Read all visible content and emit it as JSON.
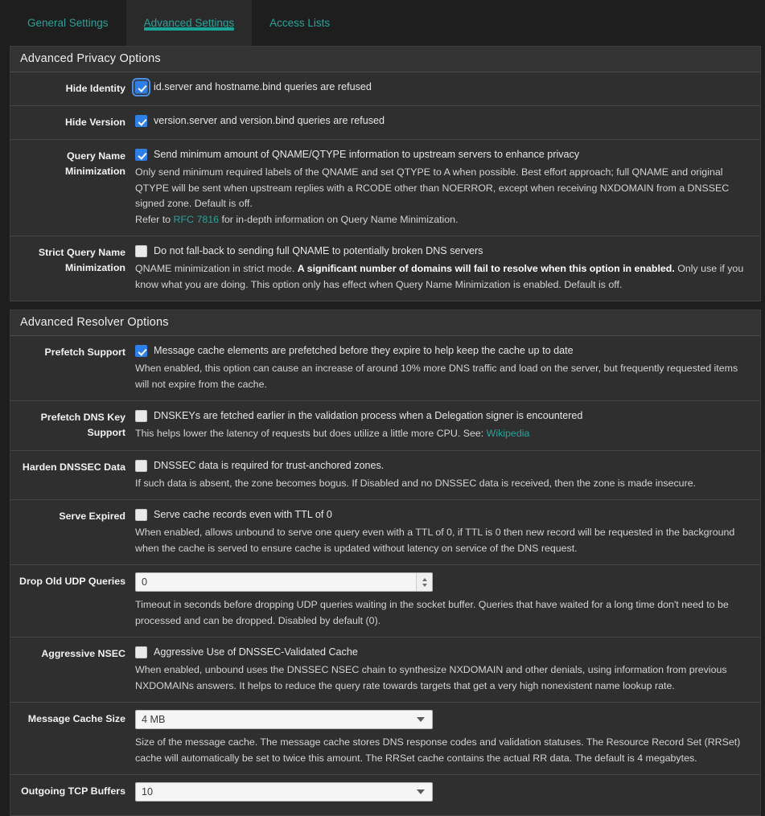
{
  "tabs": [
    {
      "label": "General Settings",
      "active": false
    },
    {
      "label": "Advanced Settings",
      "active": true
    },
    {
      "label": "Access Lists",
      "active": false
    }
  ],
  "colors": {
    "accent_teal": "#2aa198",
    "tab_underline": "#17a398",
    "checkbox_on": "#2f7fe8",
    "panel_bg": "#2f2f2f",
    "page_bg": "#1e1e1e"
  },
  "sections": [
    {
      "title": "Advanced Privacy Options",
      "rows": [
        {
          "label": "Hide Identity",
          "control": "checkbox",
          "checked": true,
          "focused": true,
          "checkbox_text": "id.server and hostname.bind queries are refused",
          "desc": []
        },
        {
          "label": "Hide Version",
          "control": "checkbox",
          "checked": true,
          "focused": false,
          "checkbox_text": "version.server and version.bind queries are refused",
          "desc": []
        },
        {
          "label": "Query Name Minimization",
          "control": "checkbox",
          "checked": true,
          "focused": false,
          "checkbox_text": "Send minimum amount of QNAME/QTYPE information to upstream servers to enhance privacy",
          "desc": [
            "Only send minimum required labels of the QNAME and set QTYPE to A when possible. Best effort approach; full QNAME and original QTYPE will be sent when upstream replies with a RCODE other than NOERROR, except when receiving NXDOMAIN from a DNSSEC signed zone. Default is off."
          ],
          "desc_link_line": {
            "before": "Refer to ",
            "link": "RFC 7816",
            "after": " for in-depth information on Query Name Minimization."
          }
        },
        {
          "label": "Strict Query Name Minimization",
          "control": "checkbox",
          "checked": false,
          "focused": false,
          "checkbox_text": "Do not fall-back to sending full QNAME to potentially broken DNS servers",
          "desc_rich": {
            "pre": "QNAME minimization in strict mode. ",
            "bold": "A significant number of domains will fail to resolve when this option in enabled.",
            "post": " Only use if you know what you are doing. This option only has effect when Query Name Minimization is enabled. Default is off."
          }
        }
      ]
    },
    {
      "title": "Advanced Resolver Options",
      "rows": [
        {
          "label": "Prefetch Support",
          "control": "checkbox",
          "checked": true,
          "focused": false,
          "checkbox_text": "Message cache elements are prefetched before they expire to help keep the cache up to date",
          "desc": [
            "When enabled, this option can cause an increase of around 10% more DNS traffic and load on the server, but frequently requested items will not expire from the cache."
          ]
        },
        {
          "label": "Prefetch DNS Key Support",
          "control": "checkbox",
          "checked": false,
          "focused": false,
          "checkbox_text": "DNSKEYs are fetched earlier in the validation process when a Delegation signer is encountered",
          "desc_link_line": {
            "before": "This helps lower the latency of requests but does utilize a little more CPU. See: ",
            "link": "Wikipedia",
            "after": ""
          }
        },
        {
          "label": "Harden DNSSEC Data",
          "control": "checkbox",
          "checked": false,
          "focused": false,
          "checkbox_text": "DNSSEC data is required for trust-anchored zones.",
          "desc": [
            "If such data is absent, the zone becomes bogus. If Disabled and no DNSSEC data is received, then the zone is made insecure."
          ]
        },
        {
          "label": "Serve Expired",
          "control": "checkbox",
          "checked": false,
          "focused": false,
          "checkbox_text": "Serve cache records even with TTL of 0",
          "desc": [
            "When enabled, allows unbound to serve one query even with a TTL of 0, if TTL is 0 then new record will be requested in the background when the cache is served to ensure cache is updated without latency on service of the DNS request."
          ]
        },
        {
          "label": "Drop Old UDP Queries",
          "control": "number",
          "value": "0",
          "desc": [
            "Timeout in seconds before dropping UDP queries waiting in the socket buffer. Queries that have waited for a long time don't need to be processed and can be dropped. Disabled by default (0)."
          ]
        },
        {
          "label": "Aggressive NSEC",
          "control": "checkbox",
          "checked": false,
          "focused": false,
          "checkbox_text": "Aggressive Use of DNSSEC-Validated Cache",
          "desc": [
            "When enabled, unbound uses the DNSSEC NSEC chain to synthesize NXDOMAIN and other denials, using information from previous NXDOMAINs answers. It helps to reduce the query rate towards targets that get a very high nonexistent name lookup rate."
          ]
        },
        {
          "label": "Message Cache Size",
          "control": "select",
          "value": "4 MB",
          "desc": [
            "Size of the message cache. The message cache stores DNS response codes and validation statuses. The Resource Record Set (RRSet) cache will automatically be set to twice this amount. The RRSet cache contains the actual RR data. The default is 4 megabytes."
          ]
        },
        {
          "label": "Outgoing TCP Buffers",
          "control": "select",
          "value": "10",
          "desc": []
        }
      ]
    }
  ]
}
